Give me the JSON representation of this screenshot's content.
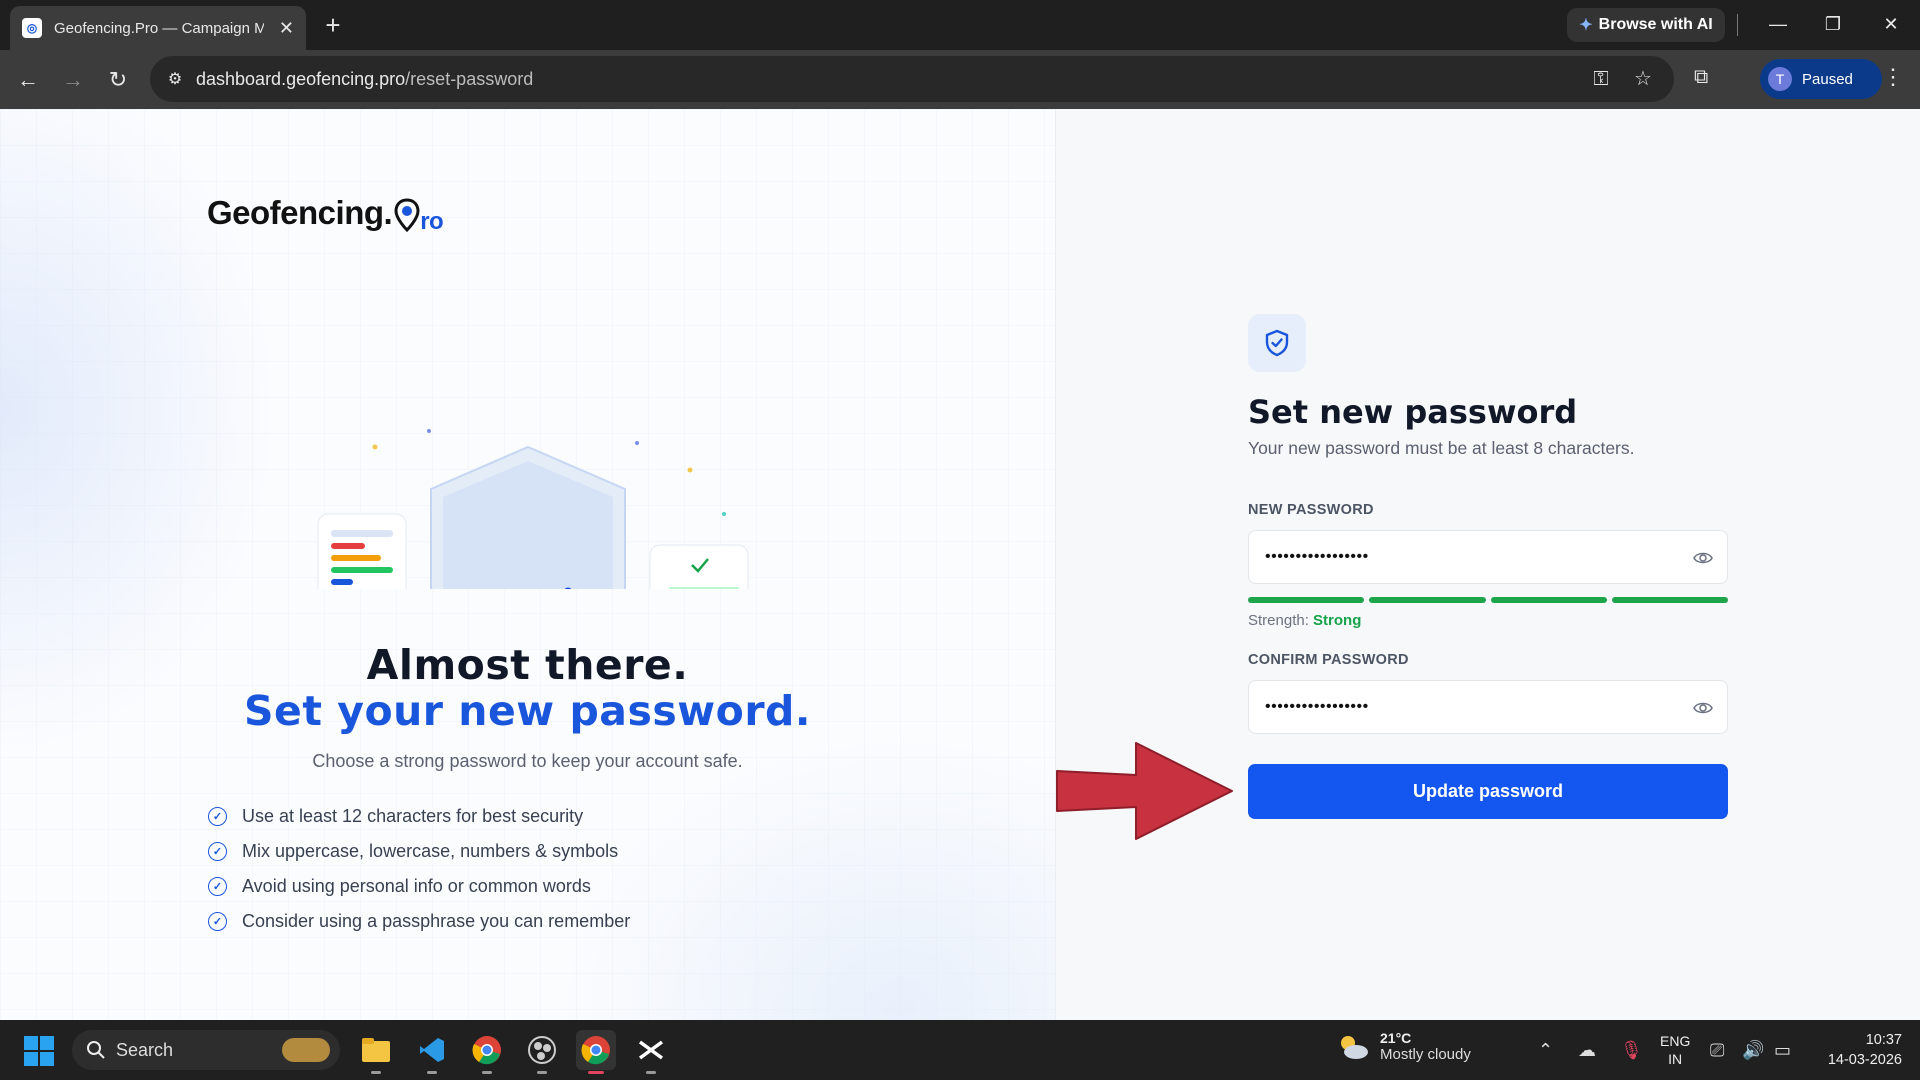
{
  "browser": {
    "tab_title": "Geofencing.Pro — Campaign M",
    "tab_favicon": "geofencing-logo",
    "browse_ai_label": "Browse with AI",
    "url_host": "dashboard.geofencing.pro",
    "url_path": "/reset-password",
    "profile_initial": "T",
    "profile_status": "Paused"
  },
  "left": {
    "logo_text": "Geofencing.",
    "logo_suffix": "ro",
    "hero_title": "Almost there.",
    "hero_title_accent": "Set your new password.",
    "hero_subtitle": "Choose a strong password to keep your account safe.",
    "tips": [
      "Use at least 12 characters for best security",
      "Mix uppercase, lowercase, numbers & symbols",
      "Avoid using personal info or common words",
      "Consider using a passphrase you can remember"
    ]
  },
  "form": {
    "icon": "shield-check-icon",
    "title": "Set new password",
    "subtitle": "Your new password must be at least 8 characters.",
    "new_password_label": "NEW PASSWORD",
    "new_password_value": "•••••••••••••••••",
    "strength_label": "Strength:",
    "strength_value": "Strong",
    "strength_segments_filled": 4,
    "confirm_password_label": "CONFIRM PASSWORD",
    "confirm_password_value": "•••••••••••••••••",
    "submit_label": "Update password"
  },
  "taskbar": {
    "search_label": "Search",
    "weather_temp": "21°C",
    "weather_desc": "Mostly cloudy",
    "lang_line1": "ENG",
    "lang_line2": "IN",
    "time": "10:37",
    "date": "14-03-2026"
  },
  "colors": {
    "brand": "#1457f0",
    "strength": "#1ea54c",
    "arrow": "#c8313f"
  }
}
